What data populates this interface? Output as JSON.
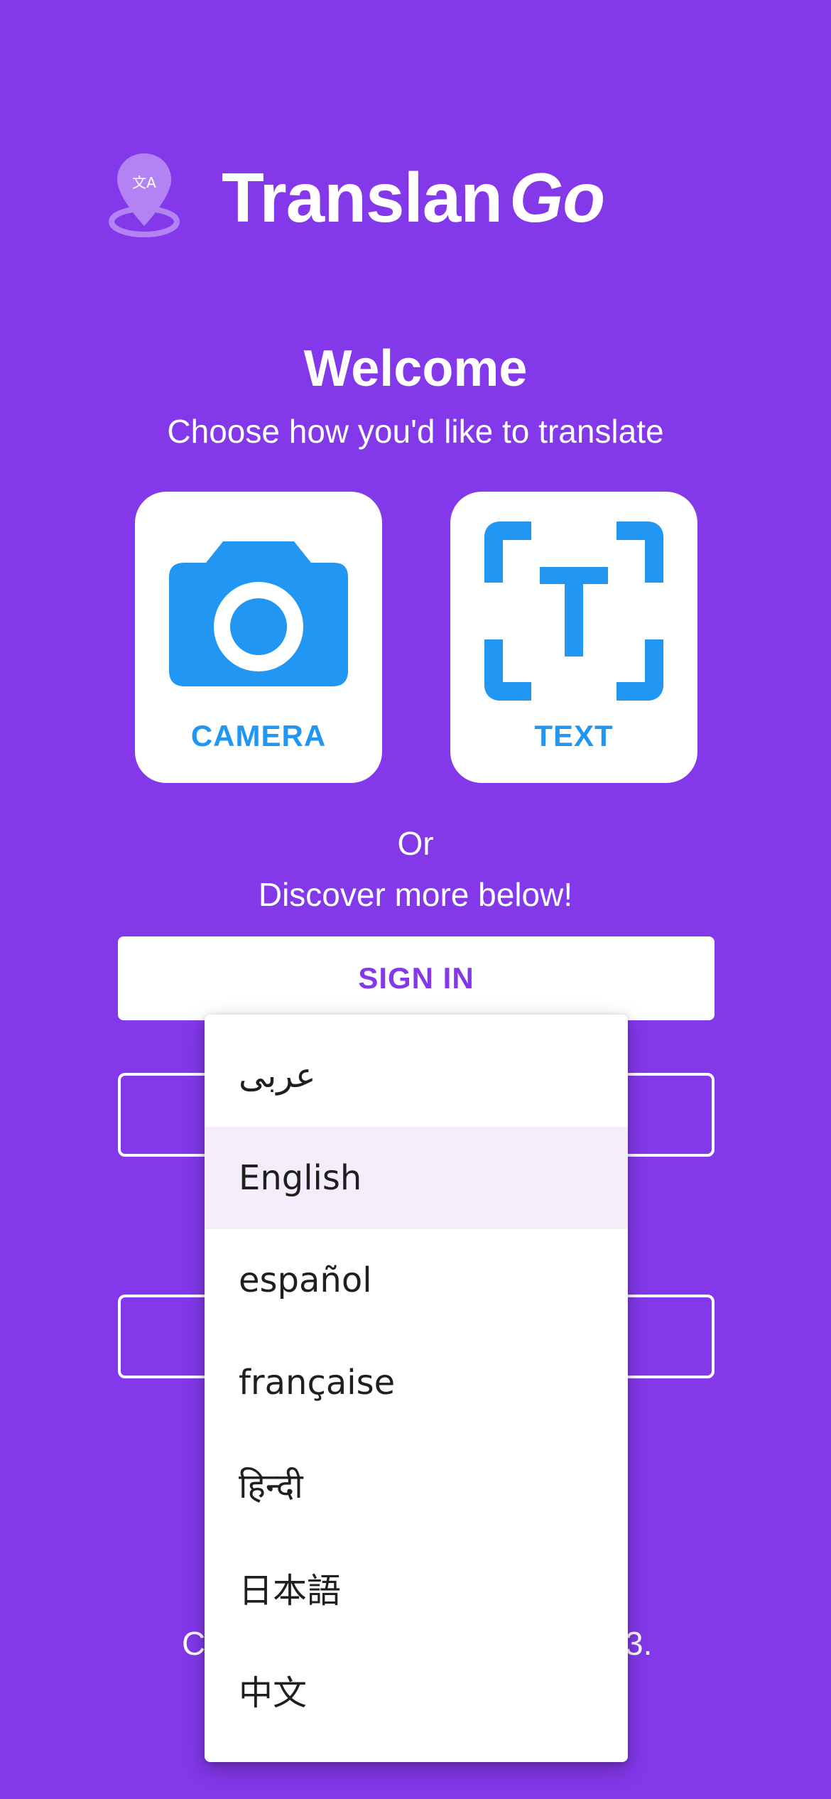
{
  "colors": {
    "background": "#8338EA",
    "card": "#FFFFFF",
    "accent_blue": "#2196F3",
    "primary_purple": "#8338EA",
    "selected_option_bg": "#F4EEFC"
  },
  "header": {
    "logo_icon": "translate-location-pin-icon",
    "app_name_part1": "Translan",
    "app_name_part2": "Go"
  },
  "welcome": {
    "title": "Welcome",
    "subtitle": "Choose how you'd like to translate"
  },
  "modes": [
    {
      "label": "CAMERA",
      "icon": "camera-icon"
    },
    {
      "label": "TEXT",
      "icon": "text-scan-icon"
    }
  ],
  "discover": {
    "or_text": "Or",
    "text": "Discover more below!"
  },
  "sign_in_label": "SIGN IN",
  "footer": {
    "left_fragment": "C",
    "right_fragment": "3."
  },
  "language_dropdown": {
    "selected": "English",
    "options": [
      "عربى",
      "English",
      "español",
      "française",
      "हिन्दी",
      "日本語",
      "中文"
    ]
  }
}
